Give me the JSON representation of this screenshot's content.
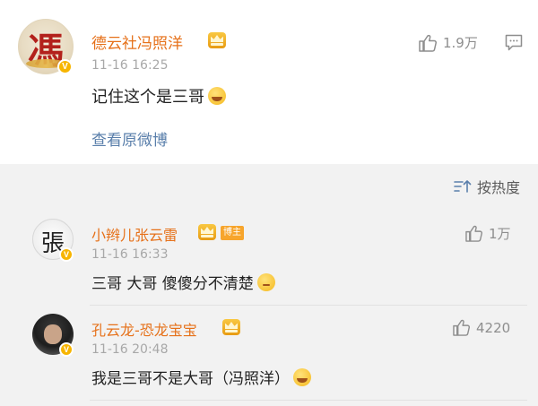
{
  "post": {
    "author": "德云社冯照洋",
    "time": "11-16 16:25",
    "text": "记住这个是三哥",
    "view_original": "查看原微博",
    "likes": "1.9万",
    "avatar_glyph": "馮"
  },
  "sort_label": "按热度",
  "comments": [
    {
      "author": "小辫儿张云雷",
      "badge": "博主",
      "time": "11-16 16:33",
      "text": "三哥 大哥 傻傻分不清楚",
      "likes": "1万"
    },
    {
      "author": "孔云龙-恐龙宝宝",
      "time": "11-16 20:48",
      "text": "我是三哥不是大哥（冯照洋）",
      "likes": "4220"
    }
  ],
  "colors": {
    "name": "#e6711a",
    "link": "#5a7fab",
    "vip": "#f7b500"
  }
}
